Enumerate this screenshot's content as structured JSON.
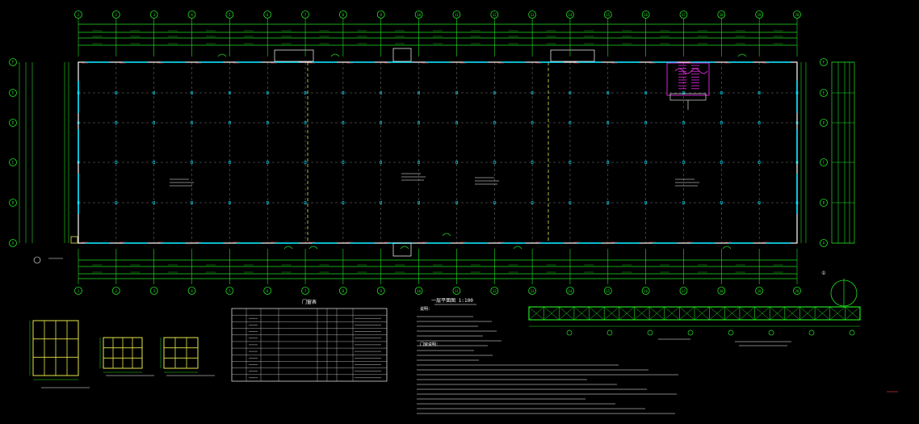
{
  "drawing": {
    "colors": {
      "background": "#000000",
      "grid_green": "#22e022",
      "wall_white": "#ffffff",
      "window_cyan": "#00e5ff",
      "axis_yellow": "#e6e64a",
      "stair_magenta": "#ff33ff",
      "dim_red": "#ff4040",
      "gray_grid": "#7a7a7a",
      "table_white": "#d8d8d8"
    },
    "table_title": "门窗表",
    "plan_title": "一层平面图 1:100",
    "notes_heading": "说明：",
    "notes_sub": "门窗说明：",
    "table_rows": 10,
    "notes_lines": 21
  },
  "chart_data": {
    "type": "floor-plan",
    "axes_numbered": [
      "1",
      "2",
      "3",
      "4",
      "5",
      "6",
      "7",
      "8",
      "9",
      "10",
      "11",
      "12",
      "13",
      "14",
      "15",
      "16",
      "17",
      "18",
      "19",
      "20"
    ],
    "axes_lettered": [
      "A",
      "B",
      "C",
      "D",
      "E",
      "F"
    ],
    "stair_icon": "stair-icon",
    "door_icon": "door-swing-icon"
  }
}
